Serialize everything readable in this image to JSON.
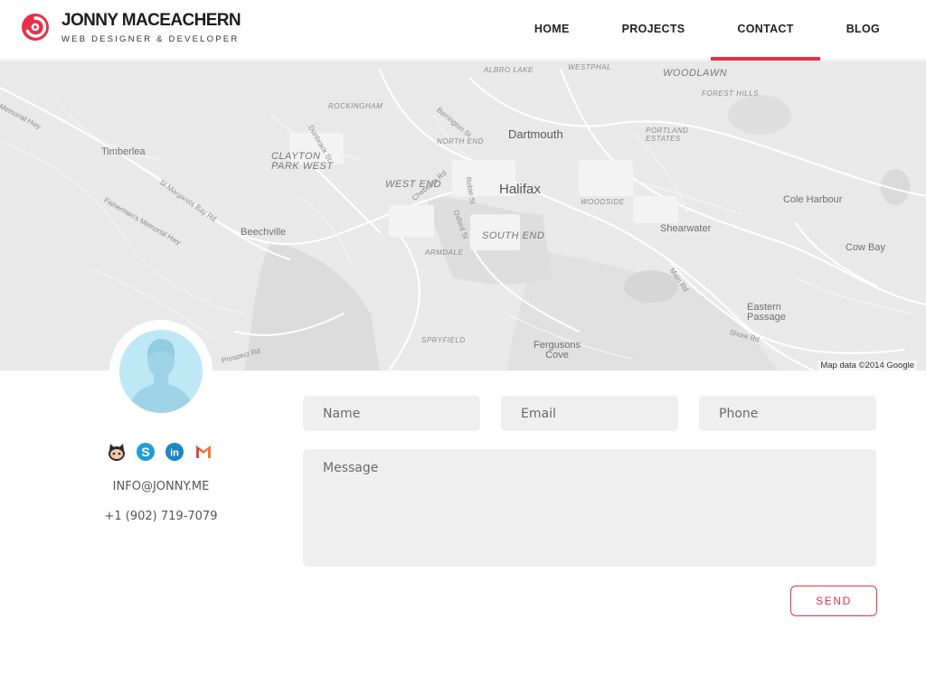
{
  "brand": {
    "name": "JONNY MACEACHERN",
    "tagline": "WEB DESIGNER & DEVELOPER",
    "accent_color": "#e8304b"
  },
  "nav": {
    "items": [
      {
        "label": "HOME",
        "active": false
      },
      {
        "label": "PROJECTS",
        "active": false
      },
      {
        "label": "CONTACT",
        "active": true
      },
      {
        "label": "BLOG",
        "active": false
      }
    ]
  },
  "map": {
    "labels": {
      "albro_lake": "ALBRO LAKE",
      "westphal": "WESTPHAL",
      "woodlawn": "WOODLAWN",
      "forest_hills": "FOREST HILLS",
      "memorial_hwy": "Memorial Hwy",
      "rockingham": "ROCKINGHAM",
      "dunbrack": "Dunbrack St",
      "barrington": "Barrington St",
      "north_end": "NORTH END",
      "dartmouth": "Dartmouth",
      "portland_estates": "PORTLAND ESTATES",
      "timberlea": "Timberlea",
      "clayton_park_west": "CLAYTON PARK WEST",
      "st_margarets": "St Margarets Bay Rd",
      "fishermens": "Fishermen's Memorial Hwy",
      "west_end": "WEST END",
      "chebucto": "Chebucto Rd",
      "robie": "Robie St",
      "halifax": "Halifax",
      "woodside": "WOODSIDE",
      "cole_harbour": "Cole Harbour",
      "oxford": "Oxford St",
      "south_end": "SOUTH END",
      "shearwater": "Shearwater",
      "beechville": "Beechville",
      "armdale": "ARMDALE",
      "cow_bay": "Cow Bay",
      "main_rd": "Main Rd",
      "eastern_passage": "Eastern Passage",
      "shore_rd": "Shore Rd",
      "prospect": "Prospect Rd",
      "spryfield": "SPRYFIELD",
      "fergusons_cove": "Fergusons Cove"
    },
    "attribution": "Map data ©2014 Google"
  },
  "profile": {
    "social_icons": [
      "github-octocat-icon",
      "skype-icon",
      "linkedin-icon",
      "gmail-icon"
    ],
    "email": "INFO@JONNY.ME",
    "phone": "+1 (902) 719-7079"
  },
  "form": {
    "name_placeholder": "Name",
    "email_placeholder": "Email",
    "phone_placeholder": "Phone",
    "message_placeholder": "Message",
    "send_label": "SEND"
  }
}
